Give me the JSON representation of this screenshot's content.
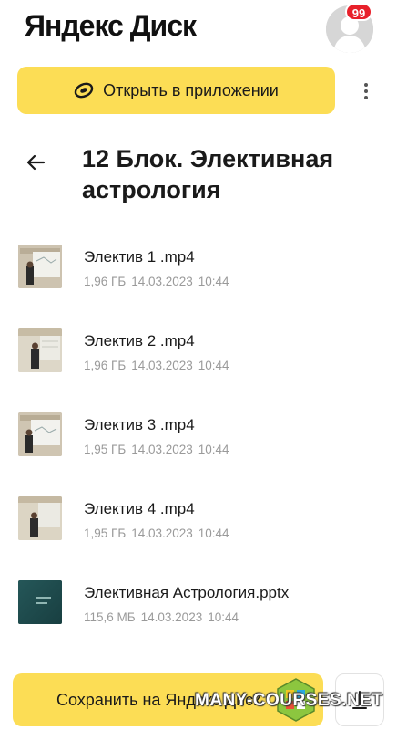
{
  "header": {
    "app_title": "Яндекс Диск",
    "notification_count": "99"
  },
  "actions": {
    "open_in_app_label": "Открыть в приложении"
  },
  "folder": {
    "title": "12 Блок. Элективная астрология"
  },
  "files": [
    {
      "name": "Электив 1 .mp4",
      "size": "1,96 ГБ",
      "date": "14.03.2023",
      "time": "10:44",
      "thumb": "video-thumbnail"
    },
    {
      "name": "Электив 2 .mp4",
      "size": "1,96 ГБ",
      "date": "14.03.2023",
      "time": "10:44",
      "thumb": "video-thumbnail"
    },
    {
      "name": "Электив 3 .mp4",
      "size": "1,95 ГБ",
      "date": "14.03.2023",
      "time": "10:44",
      "thumb": "video-thumbnail"
    },
    {
      "name": "Электив 4 .mp4",
      "size": "1,95 ГБ",
      "date": "14.03.2023",
      "time": "10:44",
      "thumb": "video-thumbnail"
    },
    {
      "name": "Элективная Астрология.pptx",
      "size": "115,6 МБ",
      "date": "14.03.2023",
      "time": "10:44",
      "thumb": "presentation-thumbnail"
    }
  ],
  "bottom_bar": {
    "save_label": "Сохранить на Яндекс Диск"
  },
  "watermark": {
    "text": "MANY-COURSES.NET"
  },
  "colors": {
    "accent_yellow": "#fcdd55",
    "badge_red": "#e8202a",
    "meta_gray": "#9a9a9a"
  }
}
